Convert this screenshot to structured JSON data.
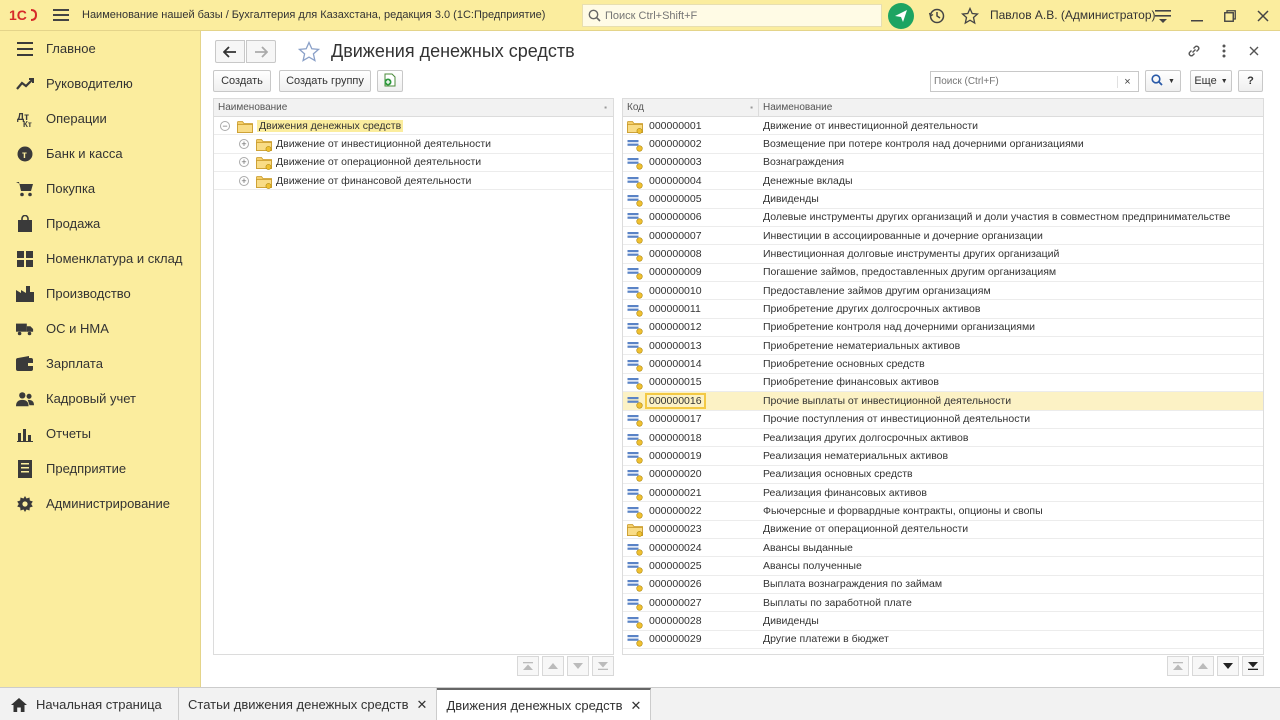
{
  "topbar": {
    "app_title": "Наименование нашей базы / Бухгалтерия для Казахстана, редакция 3.0  (1С:Предприятие)",
    "search_placeholder": "Поиск Ctrl+Shift+F",
    "user_name": "Павлов А.В. (Администратор)"
  },
  "sidebar": {
    "items": [
      {
        "label": "Главное",
        "icon": "menu-icon"
      },
      {
        "label": "Руководителю",
        "icon": "chart-line-icon"
      },
      {
        "label": "Операции",
        "icon": "operations-icon"
      },
      {
        "label": "Банк и касса",
        "icon": "coin-icon"
      },
      {
        "label": "Покупка",
        "icon": "cart-icon"
      },
      {
        "label": "Продажа",
        "icon": "bag-icon"
      },
      {
        "label": "Номенклатура и склад",
        "icon": "warehouse-icon"
      },
      {
        "label": "Производство",
        "icon": "factory-icon"
      },
      {
        "label": "ОС и НМА",
        "icon": "truck-icon"
      },
      {
        "label": "Зарплата",
        "icon": "wallet-icon"
      },
      {
        "label": "Кадровый учет",
        "icon": "people-icon"
      },
      {
        "label": "Отчеты",
        "icon": "bar-chart-icon"
      },
      {
        "label": "Предприятие",
        "icon": "building-icon"
      },
      {
        "label": "Администрирование",
        "icon": "gear-icon"
      }
    ]
  },
  "form": {
    "title": "Движения денежных средств",
    "create_label": "Создать",
    "create_group_label": "Создать группу",
    "search_placeholder": "Поиск (Ctrl+F)",
    "more_label": "Еще",
    "help_label": "?"
  },
  "tree": {
    "header": "Наименование",
    "root": "Движения денежных средств",
    "children": [
      "Движение от инвестиционной деятельности",
      "Движение от операционной деятельности",
      "Движение от финансовой деятельности"
    ]
  },
  "list": {
    "col_code": "Код",
    "col_name": "Наименование",
    "rows": [
      {
        "code": "000000001",
        "name": "Движение от инвестиционной деятельности",
        "folder": true
      },
      {
        "code": "000000002",
        "name": "Возмещение при потере контроля над дочерними организациями"
      },
      {
        "code": "000000003",
        "name": "Вознаграждения"
      },
      {
        "code": "000000004",
        "name": "Денежные вклады"
      },
      {
        "code": "000000005",
        "name": "Дивиденды"
      },
      {
        "code": "000000006",
        "name": "Долевые инструменты других организаций и доли участия в совместном предпринимательстве"
      },
      {
        "code": "000000007",
        "name": "Инвестиции в ассоциированные и дочерние организации"
      },
      {
        "code": "000000008",
        "name": "Инвестиционная долговые инструменты других организаций"
      },
      {
        "code": "000000009",
        "name": "Погашение займов, предоставленных другим организациям"
      },
      {
        "code": "000000010",
        "name": "Предоставление займов другим организациям"
      },
      {
        "code": "000000011",
        "name": "Приобретение других долгосрочных активов"
      },
      {
        "code": "000000012",
        "name": "Приобретение контроля над дочерними организациями"
      },
      {
        "code": "000000013",
        "name": "Приобретение нематериальных активов"
      },
      {
        "code": "000000014",
        "name": "Приобретение основных средств"
      },
      {
        "code": "000000015",
        "name": "Приобретение финансовых активов"
      },
      {
        "code": "000000016",
        "name": "Прочие выплаты от инвестиционной деятельности",
        "selected": true
      },
      {
        "code": "000000017",
        "name": "Прочие поступления от инвестиционной деятельности"
      },
      {
        "code": "000000018",
        "name": "Реализация других долгосрочных активов"
      },
      {
        "code": "000000019",
        "name": "Реализация нематериальных активов"
      },
      {
        "code": "000000020",
        "name": "Реализация основных средств"
      },
      {
        "code": "000000021",
        "name": "Реализация финансовых активов"
      },
      {
        "code": "000000022",
        "name": "Фьючерсные и форвардные контракты, опционы и свопы"
      },
      {
        "code": "000000023",
        "name": "Движение от операционной деятельности",
        "folder": true
      },
      {
        "code": "000000024",
        "name": "Авансы выданные"
      },
      {
        "code": "000000025",
        "name": "Авансы полученные"
      },
      {
        "code": "000000026",
        "name": "Выплата вознаграждения по займам"
      },
      {
        "code": "000000027",
        "name": "Выплаты по заработной плате"
      },
      {
        "code": "000000028",
        "name": "Дивиденды"
      },
      {
        "code": "000000029",
        "name": "Другие платежи в бюджет"
      }
    ]
  },
  "tabs": [
    {
      "label": "Начальная страница",
      "home": true
    },
    {
      "label": "Статьи движения денежных средств",
      "closable": true
    },
    {
      "label": "Движения денежных средств",
      "closable": true,
      "active": true
    }
  ],
  "colors": {
    "panel_yellow": "#fbed9e",
    "selection": "#fcf2c5",
    "accent_green": "#1da462",
    "logo_red": "#d62a2a"
  }
}
